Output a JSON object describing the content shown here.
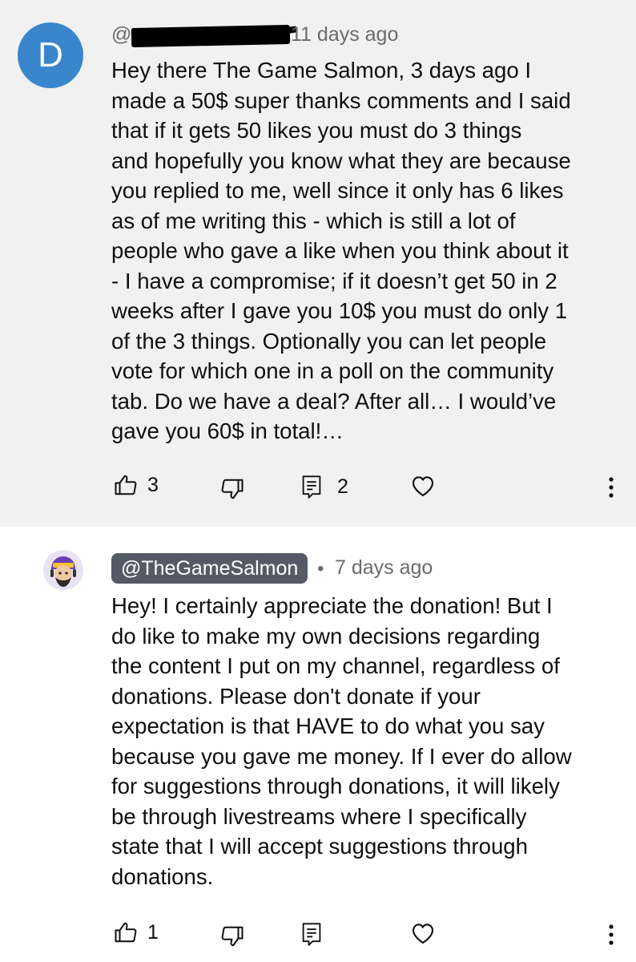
{
  "comment1": {
    "avatar_letter": "D",
    "handle_prefix": "@",
    "time": "11 days ago",
    "body": "Hey there The Game Salmon, 3 days ago I\nmade a 50$ super thanks comments and I said\nthat if it gets 50 likes you must do 3 things\nand hopefully you know what they are because\nyou replied to me, well since it only has 6 likes\nas of me writing this - which is still a lot of\npeople who gave a like when you think about it\n- I have a compromise; if it doesn’t get 50 in 2\nweeks after I gave you 10$ you must do only 1\nof the 3 things. Optionally you can let people\nvote for which one in a poll on the community\ntab. Do we have a deal? After all… I would’ve\ngave you 60$ in total!…",
    "likes": "3",
    "replies": "2"
  },
  "comment2": {
    "handle": "@TheGameSalmon",
    "separator": "•",
    "time": "7 days ago",
    "body": "Hey! I certainly appreciate the donation! But I\ndo like to make my own decisions regarding\nthe content I put on my channel, regardless of\ndonations. Please don't donate if your\nexpectation is that HAVE to do what you say\nbecause you gave me money. If I ever do allow\nfor suggestions through donations, it will likely\nbe through livestreams where I specifically\nstate that I will accept suggestions through\ndonations.",
    "likes": "1"
  },
  "icons": {
    "like": "thumbs-up-icon",
    "dislike": "thumbs-down-icon",
    "reply": "reply-icon",
    "heart": "heart-icon",
    "more": "more-vert-icon"
  },
  "colors": {
    "avatar_bg": "#3a86cc",
    "handle_pill_bg": "#555b66",
    "card_bg": "#f1f1f1"
  }
}
